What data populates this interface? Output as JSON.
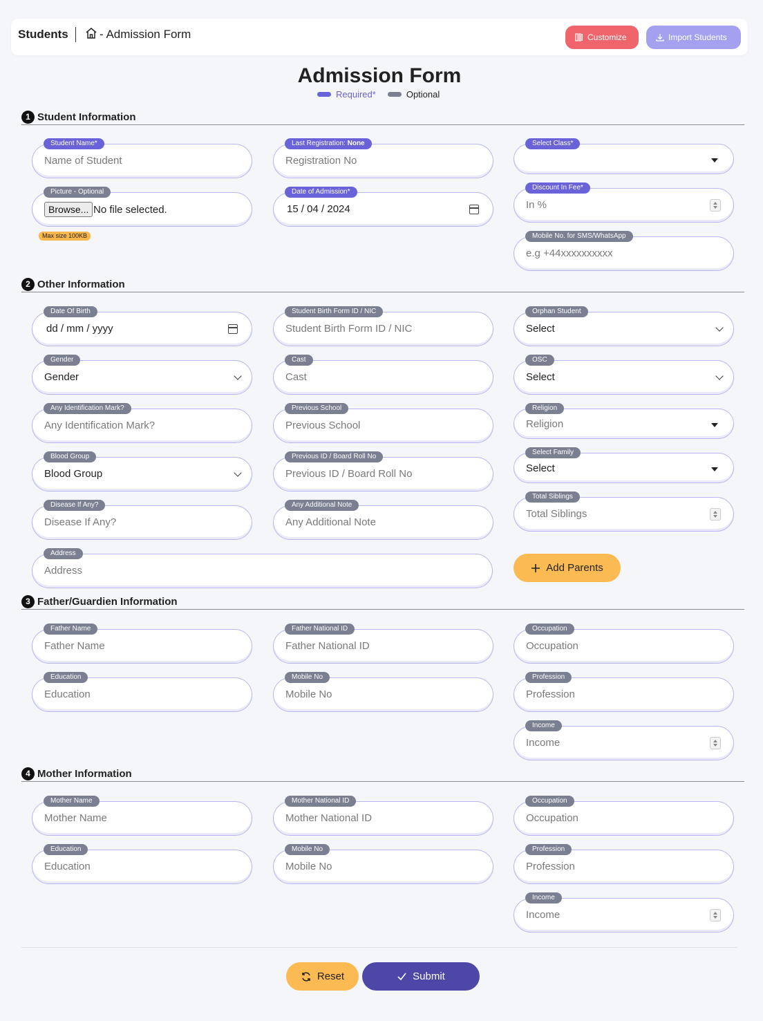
{
  "header": {
    "title": "Students",
    "page": "- Admission Form",
    "customize_label": "Customize",
    "import_label": "Import Students",
    "customize_color": "#f0646c",
    "import_color": "#a3a1f0"
  },
  "page_title": "Admission Form",
  "legend": {
    "required": "Required*",
    "optional": "Optional",
    "required_color": "#6a62d9",
    "optional_color": "#7a7f92"
  },
  "sections": {
    "student": {
      "num": "1",
      "title": "Student Information"
    },
    "other": {
      "num": "2",
      "title": "Other Information"
    },
    "father": {
      "num": "3",
      "title": "Father/Guardien Information"
    },
    "mother": {
      "num": "4",
      "title": "Mother Information"
    }
  },
  "student": {
    "name": {
      "label": "Student Name*",
      "placeholder": "Name of Student"
    },
    "registration": {
      "label": "Last Registration:",
      "label_value": "None",
      "placeholder": "Registration No"
    },
    "class": {
      "label": "Select Class*",
      "value": ""
    },
    "picture": {
      "label": "Picture - Optional",
      "browse": "Browse...",
      "status": "No file selected.",
      "hint": "Max size 100KB"
    },
    "admission_date": {
      "label": "Date of Admission*",
      "value": "15 / 04 / 2024"
    },
    "discount": {
      "label": "Discount In Fee*",
      "placeholder": "In %"
    },
    "mobile": {
      "label": "Mobile No. for SMS/WhatsApp",
      "placeholder": "e.g +44xxxxxxxxxx"
    }
  },
  "other": {
    "dob": {
      "label": "Date Of Birth",
      "value": "dd / mm / yyyy"
    },
    "birth_form": {
      "label": "Student Birth Form ID / NIC",
      "placeholder": "Student Birth Form ID / NIC"
    },
    "orphan": {
      "label": "Orphan Student",
      "value": "Select"
    },
    "gender": {
      "label": "Gender",
      "value": "Gender"
    },
    "cast": {
      "label": "Cast",
      "placeholder": "Cast"
    },
    "osc": {
      "label": "OSC",
      "value": "Select"
    },
    "id_mark": {
      "label": "Any Identification Mark?",
      "placeholder": "Any Identification Mark?"
    },
    "prev_school": {
      "label": "Previous School",
      "placeholder": "Previous School"
    },
    "religion": {
      "label": "Religion",
      "placeholder": "Religion"
    },
    "blood": {
      "label": "Blood Group",
      "value": "Blood Group"
    },
    "prev_roll": {
      "label": "Previous ID / Board Roll No",
      "placeholder": "Previous ID / Board Roll No"
    },
    "family": {
      "label": "Select Family",
      "value": "Select"
    },
    "disease": {
      "label": "Disease If Any?",
      "placeholder": "Disease If Any?"
    },
    "note": {
      "label": "Any Additional Note",
      "placeholder": "Any Additional Note"
    },
    "siblings": {
      "label": "Total Siblings",
      "placeholder": "Total Siblings"
    },
    "address": {
      "label": "Address",
      "placeholder": "Address"
    },
    "add_parents": "Add Parents"
  },
  "father": {
    "name": {
      "label": "Father Name",
      "placeholder": "Father Name"
    },
    "national_id": {
      "label": "Father National ID",
      "placeholder": "Father National ID"
    },
    "occupation": {
      "label": "Occupation",
      "placeholder": "Occupation"
    },
    "education": {
      "label": "Education",
      "placeholder": "Education"
    },
    "mobile": {
      "label": "Mobile No",
      "placeholder": "Mobile No"
    },
    "profession": {
      "label": "Profession",
      "placeholder": "Profession"
    },
    "income": {
      "label": "Income",
      "placeholder": "Income"
    }
  },
  "mother": {
    "name": {
      "label": "Mother Name",
      "placeholder": "Mother Name"
    },
    "national_id": {
      "label": "Mother National ID",
      "placeholder": "Mother National ID"
    },
    "occupation": {
      "label": "Occupation",
      "placeholder": "Occupation"
    },
    "education": {
      "label": "Education",
      "placeholder": "Education"
    },
    "mobile": {
      "label": "Mobile No",
      "placeholder": "Mobile No"
    },
    "profession": {
      "label": "Profession",
      "placeholder": "Profession"
    },
    "income": {
      "label": "Income",
      "placeholder": "Income"
    }
  },
  "actions": {
    "reset": "Reset",
    "submit": "Submit"
  }
}
